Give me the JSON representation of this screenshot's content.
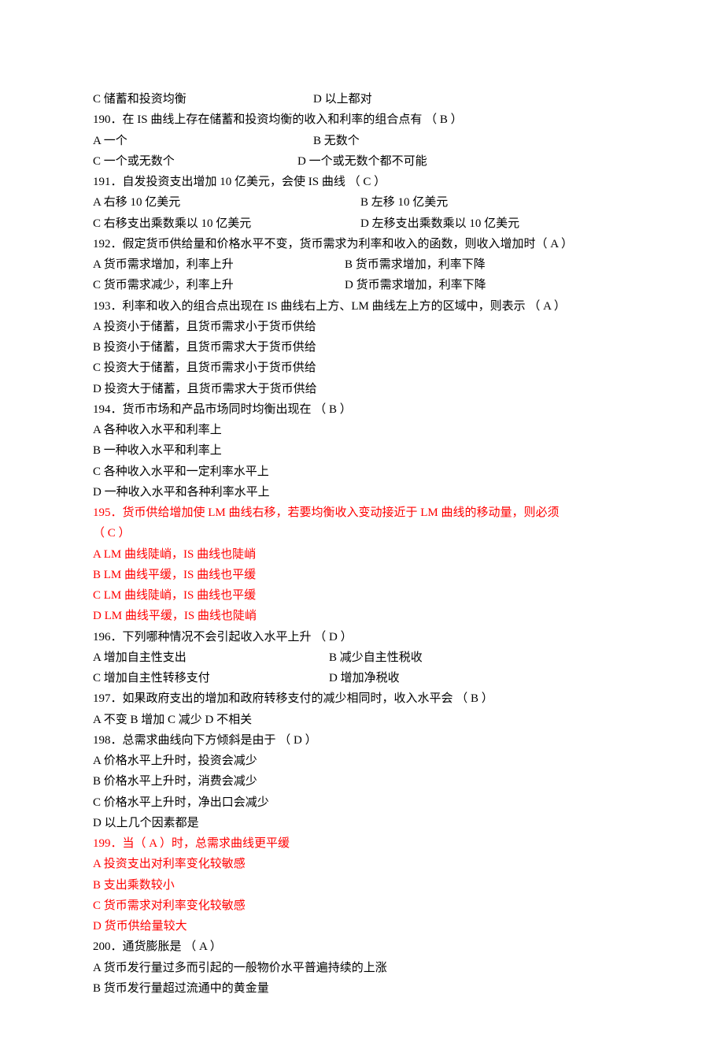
{
  "lines": [
    {
      "color": "black",
      "segments": [
        [
          "C  储蓄和投资均衡",
          280
        ],
        [
          "D  以上都对",
          0
        ]
      ]
    },
    {
      "color": "black",
      "segments": [
        [
          "190．在 IS 曲线上存在储蓄和投资均衡的收入和利率的组合点有 （ B   ）",
          0
        ]
      ]
    },
    {
      "color": "black",
      "segments": [
        [
          "A  一个",
          280
        ],
        [
          "B  无数个",
          0
        ]
      ]
    },
    {
      "color": "black",
      "segments": [
        [
          "C  一个或无数个",
          260
        ],
        [
          "D  一个或无数个都不可能",
          0
        ]
      ]
    },
    {
      "color": "black",
      "segments": [
        [
          "191．自发投资支出增加 10 亿美元，会使 IS 曲线 （ C   ）",
          0
        ]
      ]
    },
    {
      "color": "black",
      "segments": [
        [
          "A  右移 10 亿美元",
          340
        ],
        [
          "B  左移 10 亿美元",
          0
        ]
      ]
    },
    {
      "color": "black",
      "segments": [
        [
          "C  右移支出乘数乘以 10 亿美元",
          340
        ],
        [
          "D  左移支出乘数乘以 10 亿美元",
          0
        ]
      ]
    },
    {
      "color": "black",
      "segments": [
        [
          "192．假定货币供给量和价格水平不变，货币需求为利率和收入的函数，则收入增加时（ A ）",
          0
        ]
      ]
    },
    {
      "color": "black",
      "segments": [
        [
          "A  货币需求增加，利率上升",
          320
        ],
        [
          "B  货币需求增加，利率下降",
          0
        ]
      ]
    },
    {
      "color": "black",
      "segments": [
        [
          "C  货币需求减少，利率上升",
          320
        ],
        [
          "D  货币需求增加，利率下降",
          0
        ]
      ]
    },
    {
      "color": "black",
      "segments": [
        [
          "193．利率和收入的组合点出现在 IS 曲线右上方、LM 曲线左上方的区域中，则表示 （  A ）",
          0
        ]
      ]
    },
    {
      "color": "black",
      "segments": [
        [
          "A  投资小于储蓄，且货币需求小于货币供给",
          0
        ]
      ]
    },
    {
      "color": "black",
      "segments": [
        [
          "B  投资小于储蓄，且货币需求大于货币供给",
          0
        ]
      ]
    },
    {
      "color": "black",
      "segments": [
        [
          "C  投资大于储蓄，且货币需求小于货币供给",
          0
        ]
      ]
    },
    {
      "color": "black",
      "segments": [
        [
          "D  投资大于储蓄，且货币需求大于货币供给",
          0
        ]
      ]
    },
    {
      "color": "black",
      "segments": [
        [
          "194．货币市场和产品市场同时均衡出现在 （  B ）",
          0
        ]
      ]
    },
    {
      "color": "black",
      "segments": [
        [
          "A  各种收入水平和利率上",
          0
        ]
      ]
    },
    {
      "color": "black",
      "segments": [
        [
          "B  一种收入水平和利率上",
          0
        ]
      ]
    },
    {
      "color": "black",
      "segments": [
        [
          "C  各种收入水平和一定利率水平上",
          0
        ]
      ]
    },
    {
      "color": "black",
      "segments": [
        [
          "D  一种收入水平和各种利率水平上",
          0
        ]
      ]
    },
    {
      "color": "red",
      "segments": [
        [
          "195．货币供给增加使 LM 曲线右移，若要均衡收入变动接近于 LM 曲线的移动量，则必须",
          0
        ]
      ]
    },
    {
      "color": "red",
      "segments": [
        [
          "（  C ）",
          0
        ]
      ]
    },
    {
      "color": "red",
      "segments": [
        [
          "A  LM 曲线陡峭，IS 曲线也陡峭",
          0
        ]
      ]
    },
    {
      "color": "red",
      "segments": [
        [
          "B  LM 曲线平缓，IS 曲线也平缓",
          0
        ]
      ]
    },
    {
      "color": "red",
      "segments": [
        [
          "C  LM 曲线陡峭，IS 曲线也平缓",
          0
        ]
      ]
    },
    {
      "color": "red",
      "segments": [
        [
          "D  LM 曲线平缓，IS 曲线也陡峭",
          0
        ]
      ]
    },
    {
      "color": "black",
      "segments": [
        [
          "196．下列哪种情况不会引起收入水平上升 （ D   ）",
          0
        ]
      ]
    },
    {
      "color": "black",
      "segments": [
        [
          "A  增加自主性支出",
          300
        ],
        [
          "B  减少自主性税收",
          0
        ]
      ]
    },
    {
      "color": "black",
      "segments": [
        [
          "C  增加自主性转移支付",
          300
        ],
        [
          "D  增加净税收",
          0
        ]
      ]
    },
    {
      "color": "black",
      "segments": [
        [
          "197．如果政府支出的增加和政府转移支付的减少相同时，收入水平会 （   B ）",
          0
        ]
      ]
    },
    {
      "color": "black",
      "segments": [
        [
          "A  不变      B  增加      C  减少      D  不相关",
          0
        ]
      ]
    },
    {
      "color": "black",
      "segments": [
        [
          "198．总需求曲线向下方倾斜是由于 （ D  ）",
          0
        ]
      ]
    },
    {
      "color": "black",
      "segments": [
        [
          "A  价格水平上升时，投资会减少",
          0
        ]
      ]
    },
    {
      "color": "black",
      "segments": [
        [
          "B  价格水平上升时，消费会减少",
          0
        ]
      ]
    },
    {
      "color": "black",
      "segments": [
        [
          "C  价格水平上升时，净出口会减少",
          0
        ]
      ]
    },
    {
      "color": "black",
      "segments": [
        [
          "D  以上几个因素都是",
          0
        ]
      ]
    },
    {
      "color": "red",
      "segments": [
        [
          "199．当（  A  ）时，总需求曲线更平缓",
          0
        ]
      ]
    },
    {
      "color": "red",
      "segments": [
        [
          "A  投资支出对利率变化较敏感",
          0
        ]
      ]
    },
    {
      "color": "red",
      "segments": [
        [
          "B  支出乘数较小",
          0
        ]
      ]
    },
    {
      "color": "red",
      "segments": [
        [
          "C  货币需求对利率变化较敏感",
          0
        ]
      ]
    },
    {
      "color": "red",
      "segments": [
        [
          "D  货币供给量较大",
          0
        ]
      ]
    },
    {
      "color": "black",
      "segments": [
        [
          "200．通货膨胀是 （ A  ）",
          0
        ]
      ]
    },
    {
      "color": "black",
      "segments": [
        [
          "A  货币发行量过多而引起的一般物价水平普遍持续的上涨",
          0
        ]
      ]
    },
    {
      "color": "black",
      "segments": [
        [
          "B  货币发行量超过流通中的黄金量",
          0
        ]
      ]
    }
  ]
}
